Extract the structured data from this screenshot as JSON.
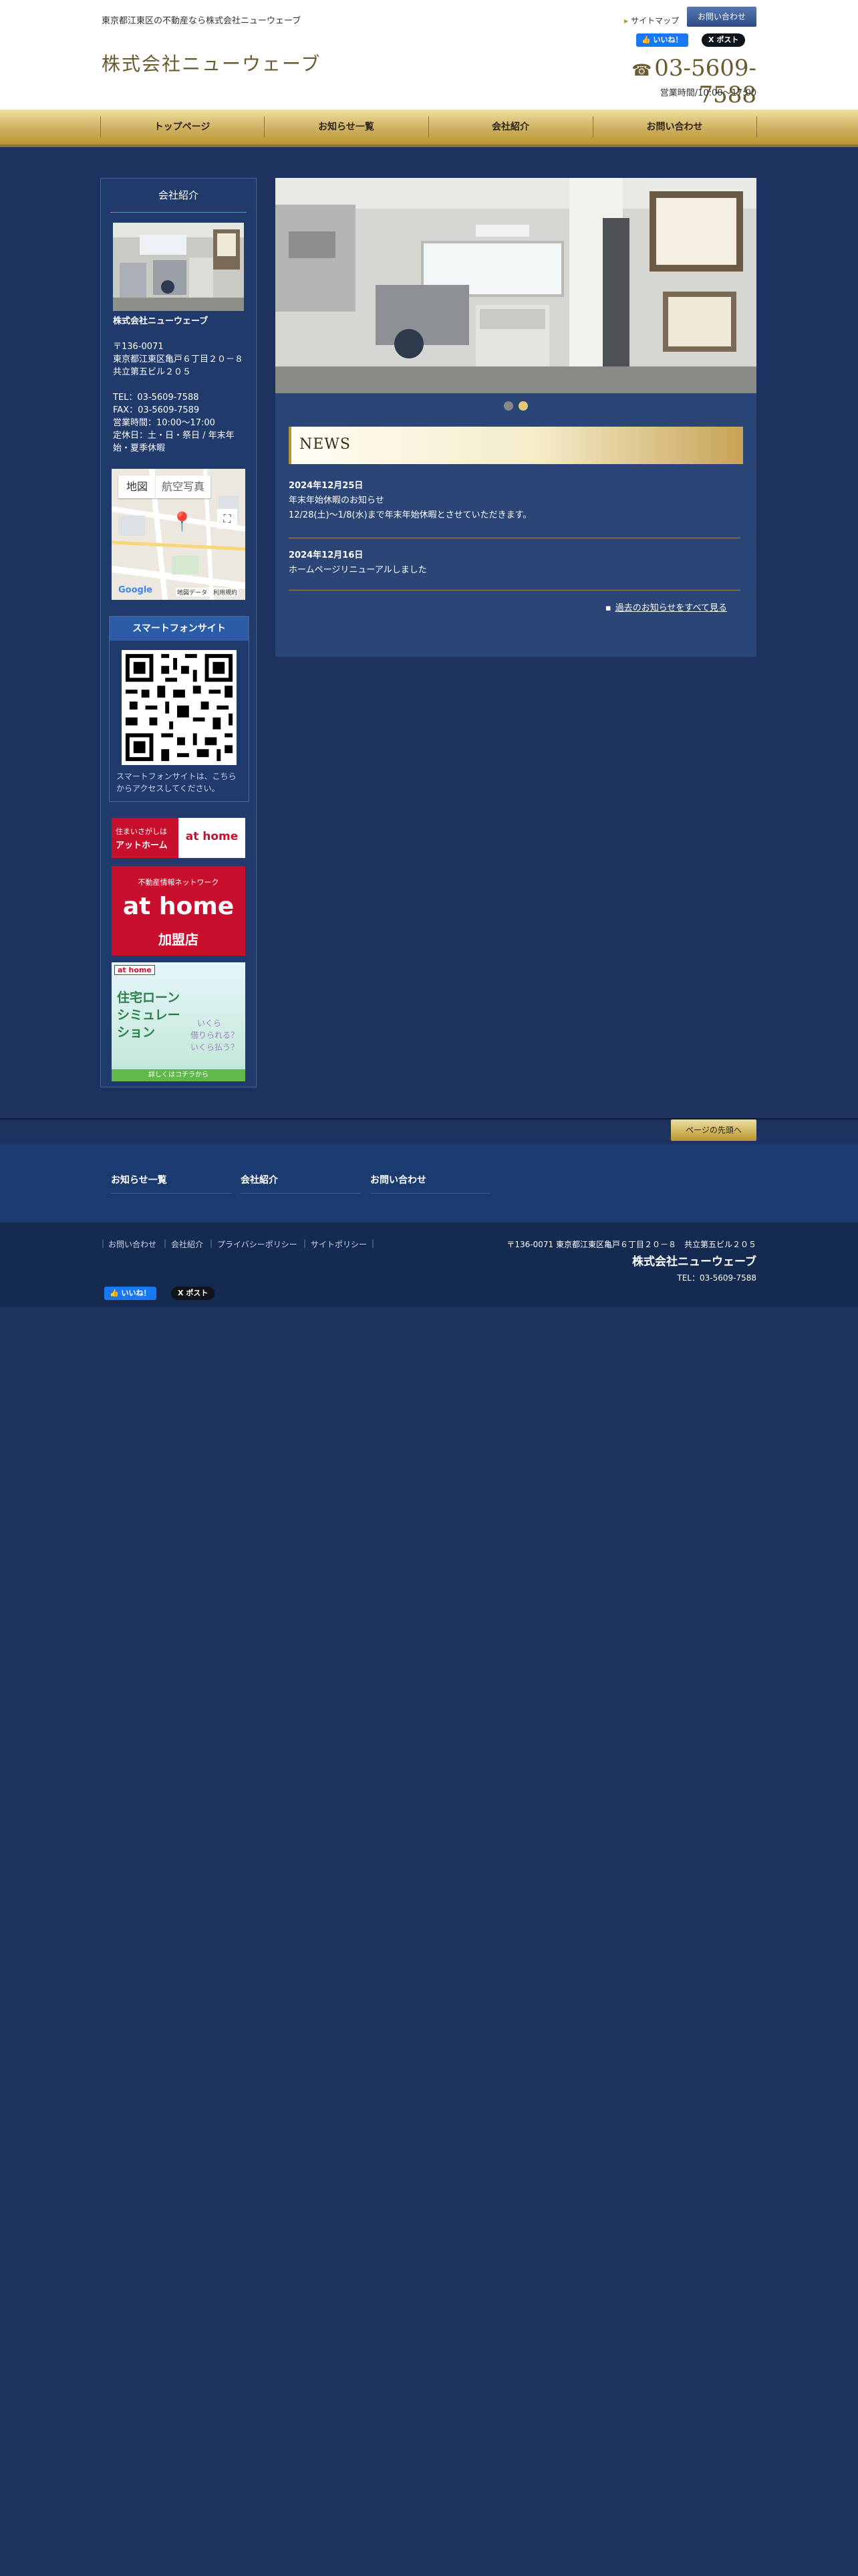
{
  "header": {
    "tagline": "東京都江東区の不動産なら株式会社ニューウェーブ",
    "logo": "株式会社ニューウェーブ",
    "sitemap": "サイトマップ",
    "contact": "お問い合わせ",
    "fb_like": "いいね！",
    "x_post": "ポスト",
    "phone": "03-5609-7588",
    "hours": "営業時間/10:00〜17:00"
  },
  "nav": [
    "トップページ",
    "お知らせ一覧",
    "会社紹介",
    "お問い合わせ"
  ],
  "sidebar": {
    "title": "会社紹介",
    "company_name": "株式会社ニューウェーブ",
    "address": "〒136-0071\n東京都江東区亀戸６丁目２０－８　共立第五ビル２０５",
    "contact": "TEL：03-5609-7588\nFAX：03-5609-7589\n営業時間：10:00〜17:00\n定休日：土・日・祭日 / 年末年始・夏季休暇",
    "map_tab_map": "地図",
    "map_tab_aerial": "航空写真",
    "map_footer": "地図データ　利用規約",
    "map_logo": "Google",
    "smartphone_title": "スマートフォンサイト",
    "smartphone_text": "スマートフォンサイトは、こちらからアクセスしてください。",
    "banner1_left_top": "住まいさがしは",
    "banner1_left_bottom": "アットホーム",
    "banner1_right": "at home",
    "banner2_top": "不動産情報ネットワーク",
    "banner2_mid": "at home",
    "banner2_bottom": "加盟店",
    "banner3_brand": "at home",
    "banner3_title": "住宅ローンシミュレーション",
    "banner3_q1": "いくら",
    "banner3_q2": "借りられる？",
    "banner3_q3": "いくら払う？",
    "banner3_cta": "詳しくはコチラから"
  },
  "main": {
    "news_title": "NEWS",
    "news": [
      {
        "date": "2024年12月25日",
        "title": "年末年始休暇のお知らせ",
        "body": "12/28(土)〜1/8(水)まで年末年始休暇とさせていただきます。"
      },
      {
        "date": "2024年12月16日",
        "title": "ホームページリニューアルしました",
        "body": ""
      }
    ],
    "more_link": "過去のお知らせをすべて見る",
    "slide_count": 2,
    "active_slide": 2
  },
  "footer": {
    "page_top": "ページの先頭へ",
    "nav": [
      "お知らせ一覧",
      "会社紹介",
      "お問い合わせ"
    ],
    "links": [
      "お問い合わせ",
      "会社紹介",
      "プライバシーポリシー",
      "サイトポリシー"
    ],
    "address": "〒136-0071 東京都江東区亀戸６丁目２０－８　共立第五ビル２０５",
    "company": "株式会社ニューウェーブ",
    "tel": "TEL：03-5609-7588",
    "fb_like": "いいね！",
    "x_post": "ポスト"
  },
  "colors": {
    "background": "#1d325e",
    "gold": "#b8962e",
    "accent_blue": "#2b5ca5"
  }
}
